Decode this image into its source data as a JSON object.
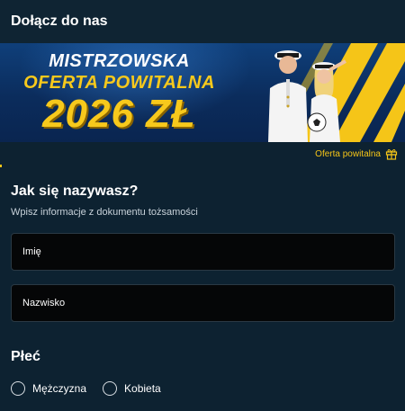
{
  "header": {
    "title": "Dołącz do nas"
  },
  "banner": {
    "line1": "MISTRZOWSKA",
    "line2": "OFERTA POWITALNA",
    "line3": "2026 ZŁ"
  },
  "offer": {
    "label": "Oferta powitalna",
    "icon": "gift-icon",
    "accent": "#f5c518"
  },
  "progress": {
    "fraction": 0.005
  },
  "form": {
    "title": "Jak się nazywasz?",
    "subtitle": "Wpisz informacje z dokumentu tożsamości",
    "first_name": {
      "placeholder": "Imię",
      "value": ""
    },
    "last_name": {
      "placeholder": "Nazwisko",
      "value": ""
    }
  },
  "gender": {
    "title": "Płeć",
    "options": [
      {
        "label": "Mężczyzna",
        "selected": false
      },
      {
        "label": "Kobieta",
        "selected": false
      }
    ]
  },
  "colors": {
    "background": "#0d2231",
    "field_bg": "#050607",
    "accent": "#f5c518"
  }
}
